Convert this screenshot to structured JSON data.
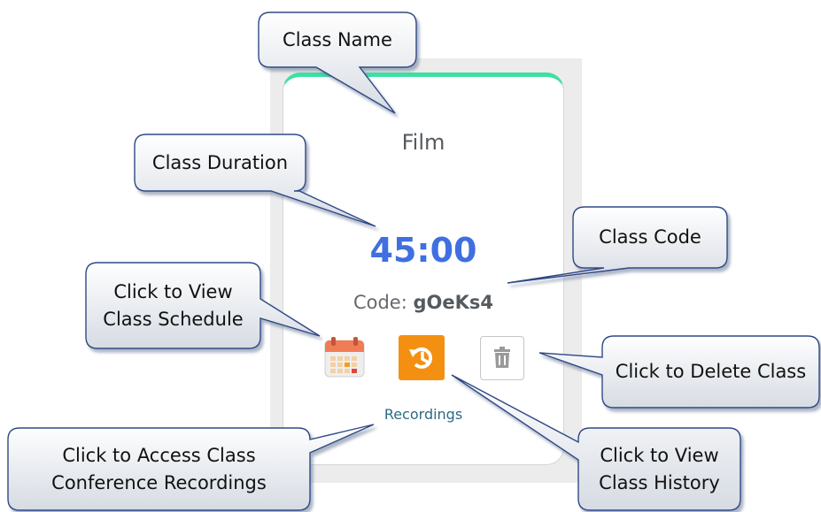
{
  "card": {
    "class_name": "Film",
    "duration": "45:00",
    "code_label": "Code:",
    "code_value": "gOeKs4",
    "recordings_label": "Recordings",
    "accent_color": "#3ee0a2",
    "duration_color": "#3f6fe0",
    "history_button_color": "#f39012"
  },
  "icons": {
    "schedule": "calendar-icon",
    "history": "history-icon",
    "delete": "trash-icon"
  },
  "callouts": {
    "class_name": "Class Name",
    "class_duration": "Class Duration",
    "class_code": "Class Code",
    "view_schedule": "Click to View\nClass Schedule",
    "delete_class": "Click to Delete Class",
    "recordings": "Click to Access Class\nConference Recordings",
    "view_history": "Click to View\nClass History"
  }
}
